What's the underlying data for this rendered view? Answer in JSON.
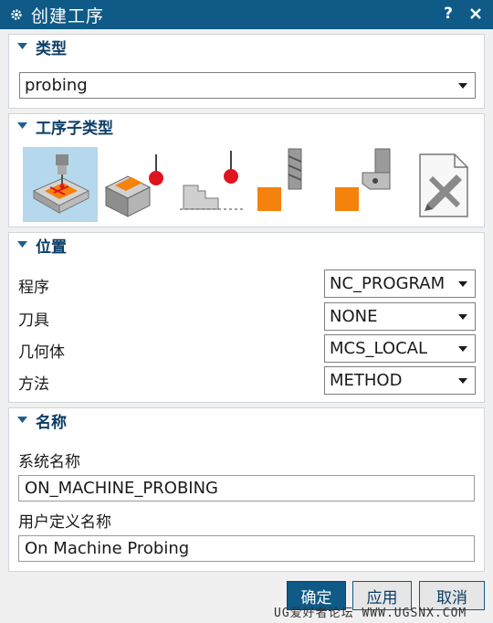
{
  "window": {
    "title": "创建工序",
    "help_label": "?",
    "gear_icon": "gear-icon",
    "close_icon": "close-icon"
  },
  "type_section": {
    "header": "类型",
    "selected": "probing"
  },
  "subtype_section": {
    "header": "工序子类型",
    "items": [
      {
        "icon": "probe-part-icon",
        "selected": true
      },
      {
        "icon": "probe-block-sphere-icon",
        "selected": false
      },
      {
        "icon": "probe-step-profile-icon",
        "selected": false
      },
      {
        "icon": "tool-measure-orange-icon",
        "selected": false
      },
      {
        "icon": "tool-holder-orange-icon",
        "selected": false
      },
      {
        "icon": "user-defined-pencil-icon",
        "selected": false
      }
    ]
  },
  "position_section": {
    "header": "位置",
    "rows": [
      {
        "label": "程序",
        "value": "NC_PROGRAM"
      },
      {
        "label": "刀具",
        "value": "NONE"
      },
      {
        "label": "几何体",
        "value": "MCS_LOCAL"
      },
      {
        "label": "方法",
        "value": "METHOD"
      }
    ]
  },
  "name_section": {
    "header": "名称",
    "system_name_label": "系统名称",
    "system_name_value": "ON_MACHINE_PROBING",
    "user_name_label": "用户定义名称",
    "user_name_value": "On Machine Probing"
  },
  "buttons": {
    "ok": "确定",
    "apply": "应用",
    "cancel": "取消"
  },
  "watermark": "UG爱好者论坛 WWW.UGSNX.COM",
  "colors": {
    "titlebar": "#0f5a86",
    "section_header_text": "#0b3d66",
    "selected_subtype_bg": "#b5d8ec",
    "accent_orange": "#f5820d",
    "probe_red": "#e0141e"
  }
}
